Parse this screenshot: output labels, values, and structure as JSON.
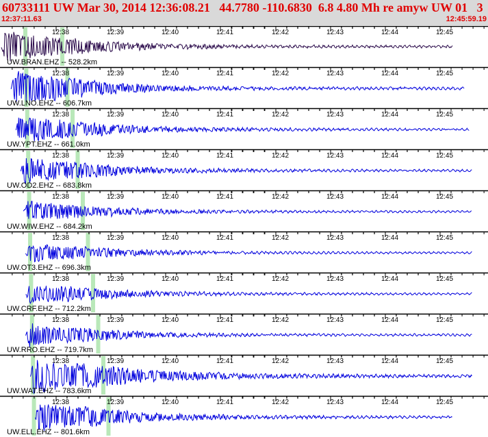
{
  "header": {
    "title": "60733111 UW Mar 30, 2014 12:36:08.21   44.7780 -110.6830  6.8 4.80 Mh re amyw UW 01   3",
    "start_time": "12:37:11.63",
    "end_time": "12:45:59.19"
  },
  "chart_data": {
    "type": "line",
    "time_ticks": [
      "12:38",
      "12:39",
      "12:40",
      "12:41",
      "12:42",
      "12:43",
      "12:44",
      "12:45"
    ],
    "channels": [
      {
        "label": "UW.BRAN.EHZ -- 528.2km",
        "color": "#2a0a4a",
        "onset": 0.0,
        "end": 0.93,
        "amp": 0.9
      },
      {
        "label": "UW.LNO.EHZ -- 606.7km",
        "color": "#0000dd",
        "onset": 0.02,
        "end": 0.955,
        "amp": 1.0
      },
      {
        "label": "UW.YPT.EHZ -- 661.0km",
        "color": "#0000dd",
        "onset": 0.03,
        "end": 0.965,
        "amp": 0.8
      },
      {
        "label": "UW.OD2.EHZ -- 683.8km",
        "color": "#0000dd",
        "onset": 0.04,
        "end": 0.97,
        "amp": 0.75
      },
      {
        "label": "UW.WIW.EHZ -- 684.2km",
        "color": "#0000dd",
        "onset": 0.045,
        "end": 0.97,
        "amp": 0.6
      },
      {
        "label": "UW.OT3.EHZ -- 696.3km",
        "color": "#0000dd",
        "onset": 0.05,
        "end": 0.97,
        "amp": 0.55
      },
      {
        "label": "UW.CRF.EHZ -- 712.2km",
        "color": "#0000dd",
        "onset": 0.05,
        "end": 0.97,
        "amp": 0.6
      },
      {
        "label": "UW.RRO.EHZ -- 719.7km",
        "color": "#0000dd",
        "onset": 0.05,
        "end": 0.97,
        "amp": 0.65
      },
      {
        "label": "UW.WAT.EHZ -- 783.6km",
        "color": "#0000dd",
        "onset": 0.06,
        "end": 0.97,
        "amp": 1.0
      },
      {
        "label": "UW.ELL.EHZ -- 801.6km",
        "color": "#0000dd",
        "onset": 0.07,
        "end": 0.93,
        "amp": 0.9
      }
    ]
  }
}
